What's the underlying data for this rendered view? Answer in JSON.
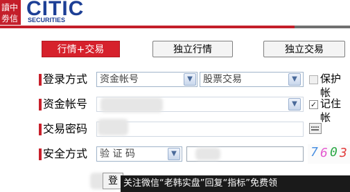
{
  "header": {
    "logo_text": "CITIC",
    "logo_sub": "SECURITIES",
    "logo_mark_text": "中信證券"
  },
  "tabs": {
    "active": "行情+交易",
    "independent_quote": "独立行情",
    "independent_trade": "独立交易"
  },
  "form": {
    "login_method_label": "登录方式",
    "account_type_value": "资金帐号",
    "trade_type_value": "股票交易",
    "protect_label": "保护帐",
    "account_label": "资金帐号",
    "remember_label": "记住帐",
    "remember_checked": "✓",
    "password_label": "交易密码",
    "security_label": "安全方式",
    "security_value": "验 证 码",
    "captcha": [
      "7",
      "6",
      "0",
      "3"
    ],
    "login_button": "登"
  },
  "banner": {
    "text": "关注微信“老韩实盘”回复“指标”免费领"
  },
  "colors": {
    "brand_red": "#d6212c",
    "brand_blue": "#1d3f95"
  }
}
